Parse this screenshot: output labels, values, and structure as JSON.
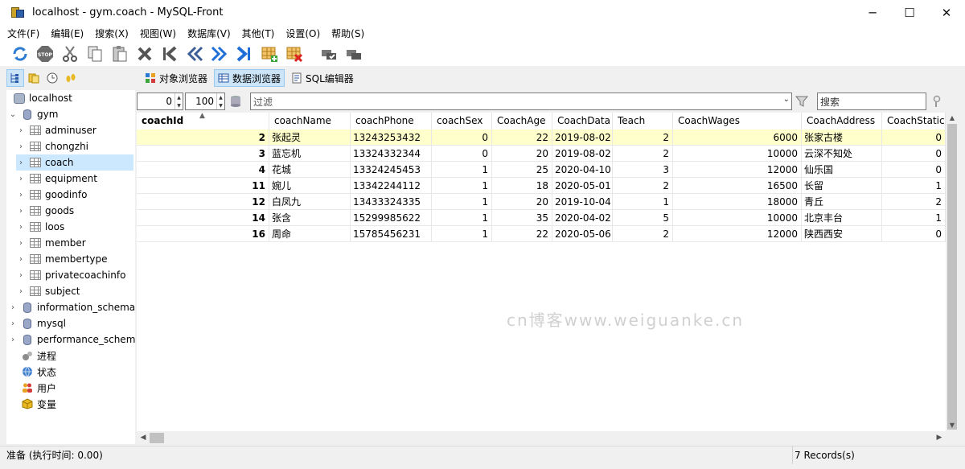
{
  "window": {
    "title": "localhost - gym.coach - MySQL-Front",
    "minimize_glyph": "─",
    "maximize_glyph": "☐",
    "close_glyph": "✕"
  },
  "menubar": [
    "文件(F)",
    "编辑(E)",
    "搜索(X)",
    "视图(W)",
    "数据库(V)",
    "其他(T)",
    "设置(O)",
    "帮助(S)"
  ],
  "toolbar": {
    "icons": [
      "refresh-icon",
      "stop-icon",
      "cut-icon",
      "copy-icon",
      "paste-icon",
      "delete-icon",
      "first-record-icon",
      "prev-record-icon",
      "next-record-icon",
      "last-record-icon",
      "insert-record-icon",
      "delete-record-icon",
      "post-icon",
      "cancel-icon"
    ]
  },
  "view_tabs": [
    {
      "label": "对象浏览器",
      "active": false
    },
    {
      "label": "数据浏览器",
      "active": true
    },
    {
      "label": "SQL编辑器",
      "active": false
    }
  ],
  "tree": {
    "host": "localhost",
    "database": "gym",
    "tables": [
      "adminuser",
      "chongzhi",
      "coach",
      "equipment",
      "goodinfo",
      "goods",
      "loos",
      "member",
      "membertype",
      "privatecoachinfo",
      "subject"
    ],
    "selected_table": "coach",
    "other_databases": [
      "information_schema",
      "mysql",
      "performance_schema"
    ],
    "extras": [
      "进程",
      "状态",
      "用户",
      "变量"
    ]
  },
  "filter": {
    "offset": "0",
    "limit": "100",
    "filter_placeholder": "过滤",
    "search_placeholder": "搜索"
  },
  "grid": {
    "columns": [
      "coachId",
      "coachName",
      "coachPhone",
      "coachSex",
      "CoachAge",
      "CoachData",
      "Teach",
      "CoachWages",
      "CoachAddress",
      "CoachStatic"
    ],
    "rows": [
      [
        "2",
        "张起灵",
        "13243253432",
        "0",
        "22",
        "2019-08-02",
        "2",
        "6000",
        "张家古楼",
        "0"
      ],
      [
        "3",
        "蓝忘机",
        "13324332344",
        "0",
        "20",
        "2019-08-02",
        "2",
        "10000",
        "云深不知处",
        "0"
      ],
      [
        "4",
        "花城",
        "13324245453",
        "1",
        "25",
        "2020-04-10",
        "3",
        "12000",
        "仙乐国",
        "0"
      ],
      [
        "11",
        "婉儿",
        "13342244112",
        "1",
        "18",
        "2020-05-01",
        "2",
        "16500",
        "长留",
        "1"
      ],
      [
        "12",
        "白凤九",
        "13433324335",
        "1",
        "20",
        "2019-10-04",
        "1",
        "18000",
        "青丘",
        "2"
      ],
      [
        "14",
        "张含",
        "15299985622",
        "1",
        "35",
        "2020-04-02",
        "5",
        "10000",
        "北京丰台",
        "1"
      ],
      [
        "16",
        "周命",
        "15785456231",
        "1",
        "22",
        "2020-05-06",
        "2",
        "12000",
        "陕西西安",
        "0"
      ]
    ]
  },
  "watermark": "cn博客www.weiguanke.cn",
  "status": {
    "left": "准备  (执行时间: 0.00)",
    "right": "7 Records(s)"
  }
}
